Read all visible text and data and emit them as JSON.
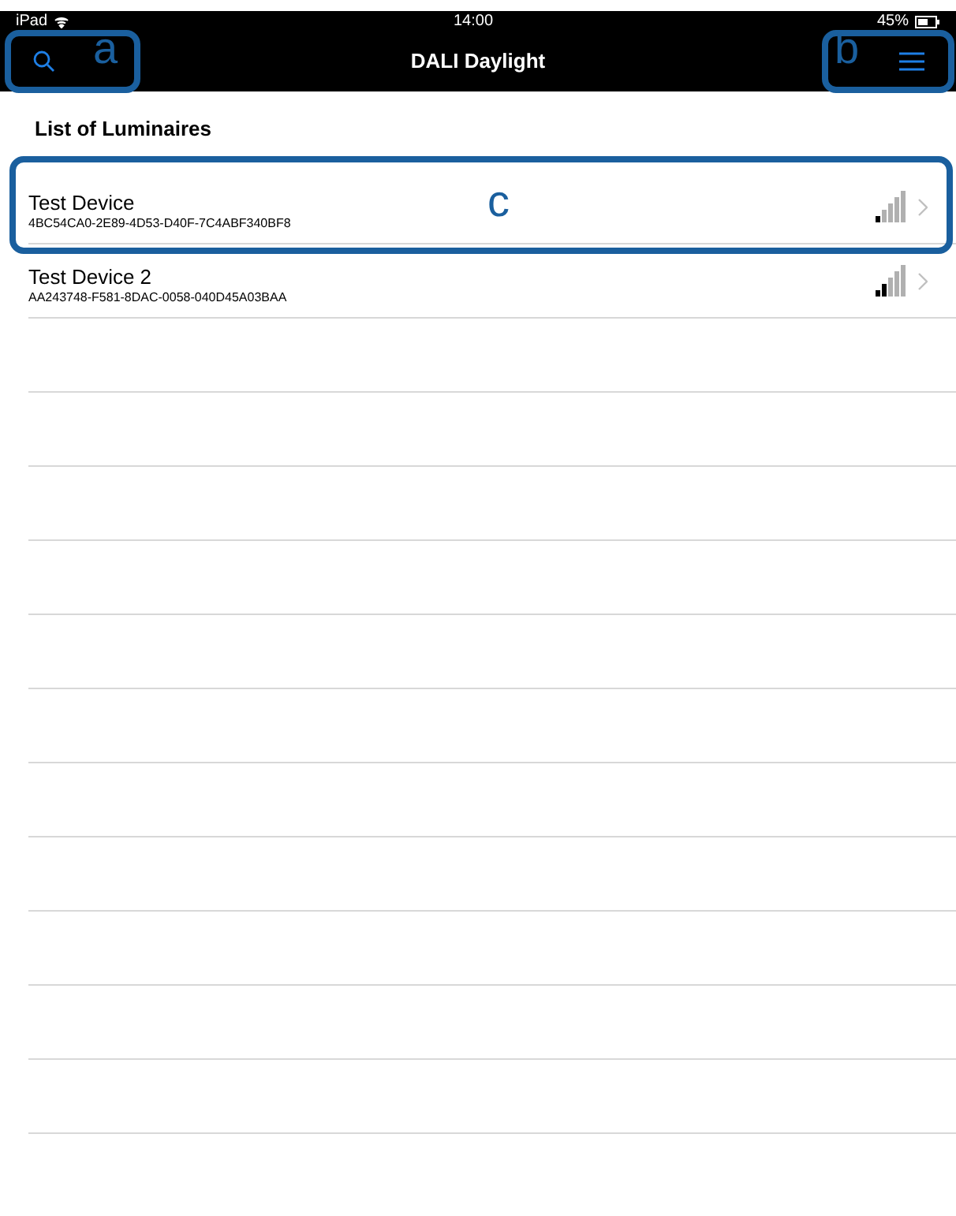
{
  "status_bar": {
    "device": "iPad",
    "time": "14:00",
    "battery": "45%"
  },
  "nav_bar": {
    "title": "DALI Daylight"
  },
  "section_title": "List of Luminaires",
  "luminaires": [
    {
      "name": "Test Device",
      "id": "4BC54CA0-2E89-4D53-D40F-7C4ABF340BF8",
      "level": 0.2
    },
    {
      "name": "Test Device 2",
      "id": "AA243748-F581-8DAC-0058-040D45A03BAA",
      "level": 0.4
    }
  ],
  "callouts": [
    {
      "label": "a"
    },
    {
      "label": "b"
    },
    {
      "label": "c"
    }
  ]
}
